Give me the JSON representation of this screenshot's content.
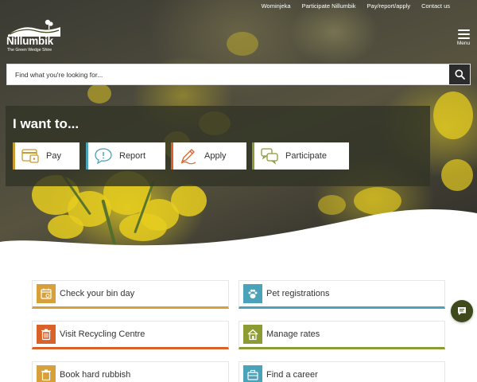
{
  "header": {
    "top_links": [
      "Wominjeka",
      "Participate Nillumbik",
      "Pay/report/apply",
      "Contact us"
    ],
    "logo_name": "Nillumbik",
    "logo_tagline": "The Green Wedge Shire",
    "menu_label": "Menu"
  },
  "search": {
    "placeholder": "Find what you're looking for...",
    "icon": "search-icon"
  },
  "i_want": {
    "title": "I want to...",
    "actions": [
      {
        "label": "Pay",
        "icon": "pay-icon",
        "accent": "#c99a2e"
      },
      {
        "label": "Report",
        "icon": "report-icon",
        "accent": "#4aa3b8"
      },
      {
        "label": "Apply",
        "icon": "apply-icon",
        "accent": "#d9622b"
      },
      {
        "label": "Participate",
        "icon": "participate-icon",
        "accent": "#8c9b33"
      }
    ]
  },
  "tiles": [
    {
      "label": "Check your bin day",
      "icon": "calendar-icon",
      "color": "#d8a03a"
    },
    {
      "label": "Pet registrations",
      "icon": "paw-icon",
      "color": "#4aa3b8"
    },
    {
      "label": "Visit Recycling Centre",
      "icon": "bin-icon",
      "color": "#d9622b"
    },
    {
      "label": "Manage rates",
      "icon": "house-icon",
      "color": "#8c9b33"
    },
    {
      "label": "Book hard rubbish",
      "icon": "rubbish-icon",
      "color": "#d8a03a"
    },
    {
      "label": "Find a career",
      "icon": "briefcase-icon",
      "color": "#4aa3b8"
    }
  ],
  "chat": {
    "icon": "chat-icon",
    "color": "#3f4a1c"
  }
}
